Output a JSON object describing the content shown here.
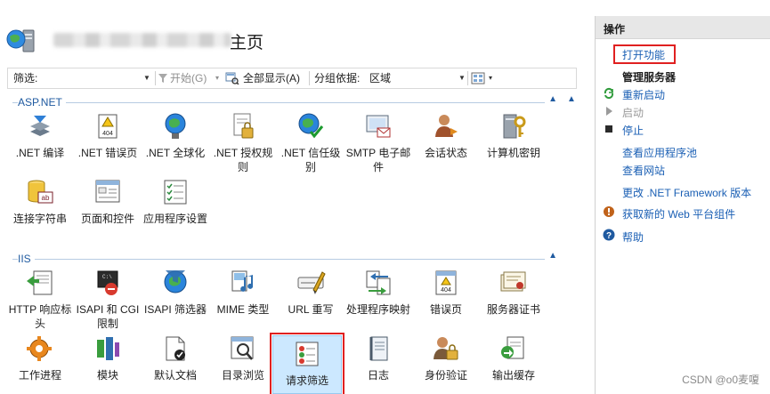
{
  "header": {
    "title_suffix": "主页"
  },
  "toolbar": {
    "filter_label": "筛选:",
    "filter_value": "",
    "start_label": "开始(G)",
    "show_all_label": "全部显示(A)",
    "group_by_label": "分组依据:",
    "group_by_value": "区域"
  },
  "sections": [
    {
      "name": "ASP.NET",
      "tiles": [
        {
          "label": ".NET 编译",
          "icon": "dotnet-compile-icon"
        },
        {
          "label": ".NET 错误页",
          "icon": "dotnet-error-pages-icon"
        },
        {
          "label": ".NET 全球化",
          "icon": "dotnet-globalization-icon"
        },
        {
          "label": ".NET 授权规则",
          "icon": "dotnet-authorization-icon"
        },
        {
          "label": ".NET 信任级别",
          "icon": "dotnet-trust-levels-icon"
        },
        {
          "label": "SMTP 电子邮件",
          "icon": "smtp-email-icon"
        },
        {
          "label": "会话状态",
          "icon": "session-state-icon"
        },
        {
          "label": "计算机密钥",
          "icon": "machine-key-icon"
        },
        {
          "label": "连接字符串",
          "icon": "connection-strings-icon"
        },
        {
          "label": "页面和控件",
          "icon": "pages-controls-icon"
        },
        {
          "label": "应用程序设置",
          "icon": "application-settings-icon"
        }
      ]
    },
    {
      "name": "IIS",
      "tiles": [
        {
          "label": "HTTP 响应标头",
          "icon": "http-response-headers-icon"
        },
        {
          "label": "ISAPI 和 CGI 限制",
          "icon": "isapi-cgi-restrictions-icon"
        },
        {
          "label": "ISAPI 筛选器",
          "icon": "isapi-filters-icon"
        },
        {
          "label": "MIME 类型",
          "icon": "mime-types-icon"
        },
        {
          "label": "URL 重写",
          "icon": "url-rewrite-icon"
        },
        {
          "label": "处理程序映射",
          "icon": "handler-mappings-icon"
        },
        {
          "label": "错误页",
          "icon": "error-pages-icon"
        },
        {
          "label": "服务器证书",
          "icon": "server-certificates-icon"
        },
        {
          "label": "工作进程",
          "icon": "worker-processes-icon"
        },
        {
          "label": "模块",
          "icon": "modules-icon"
        },
        {
          "label": "默认文档",
          "icon": "default-document-icon"
        },
        {
          "label": "目录浏览",
          "icon": "directory-browsing-icon"
        },
        {
          "label": "请求筛选",
          "icon": "request-filtering-icon",
          "selected": true
        },
        {
          "label": "日志",
          "icon": "logging-icon"
        },
        {
          "label": "身份验证",
          "icon": "authentication-icon"
        },
        {
          "label": "输出缓存",
          "icon": "output-caching-icon"
        }
      ]
    }
  ],
  "actions": {
    "title": "操作",
    "open_feature": "打开功能",
    "manage_server": "管理服务器",
    "restart": "重新启动",
    "start": "启动",
    "stop": "停止",
    "view_app_pools": "查看应用程序池",
    "view_sites": "查看网站",
    "change_framework": "更改 .NET Framework 版本",
    "get_web_platform": "获取新的 Web 平台组件",
    "help": "帮助"
  },
  "watermark": "CSDN @o0麦嗄",
  "colors": {
    "accent": "#1a5fb4",
    "highlight_border": "#e02020",
    "selected_fill": "#cce8ff",
    "section_text": "#1f5aa0"
  }
}
